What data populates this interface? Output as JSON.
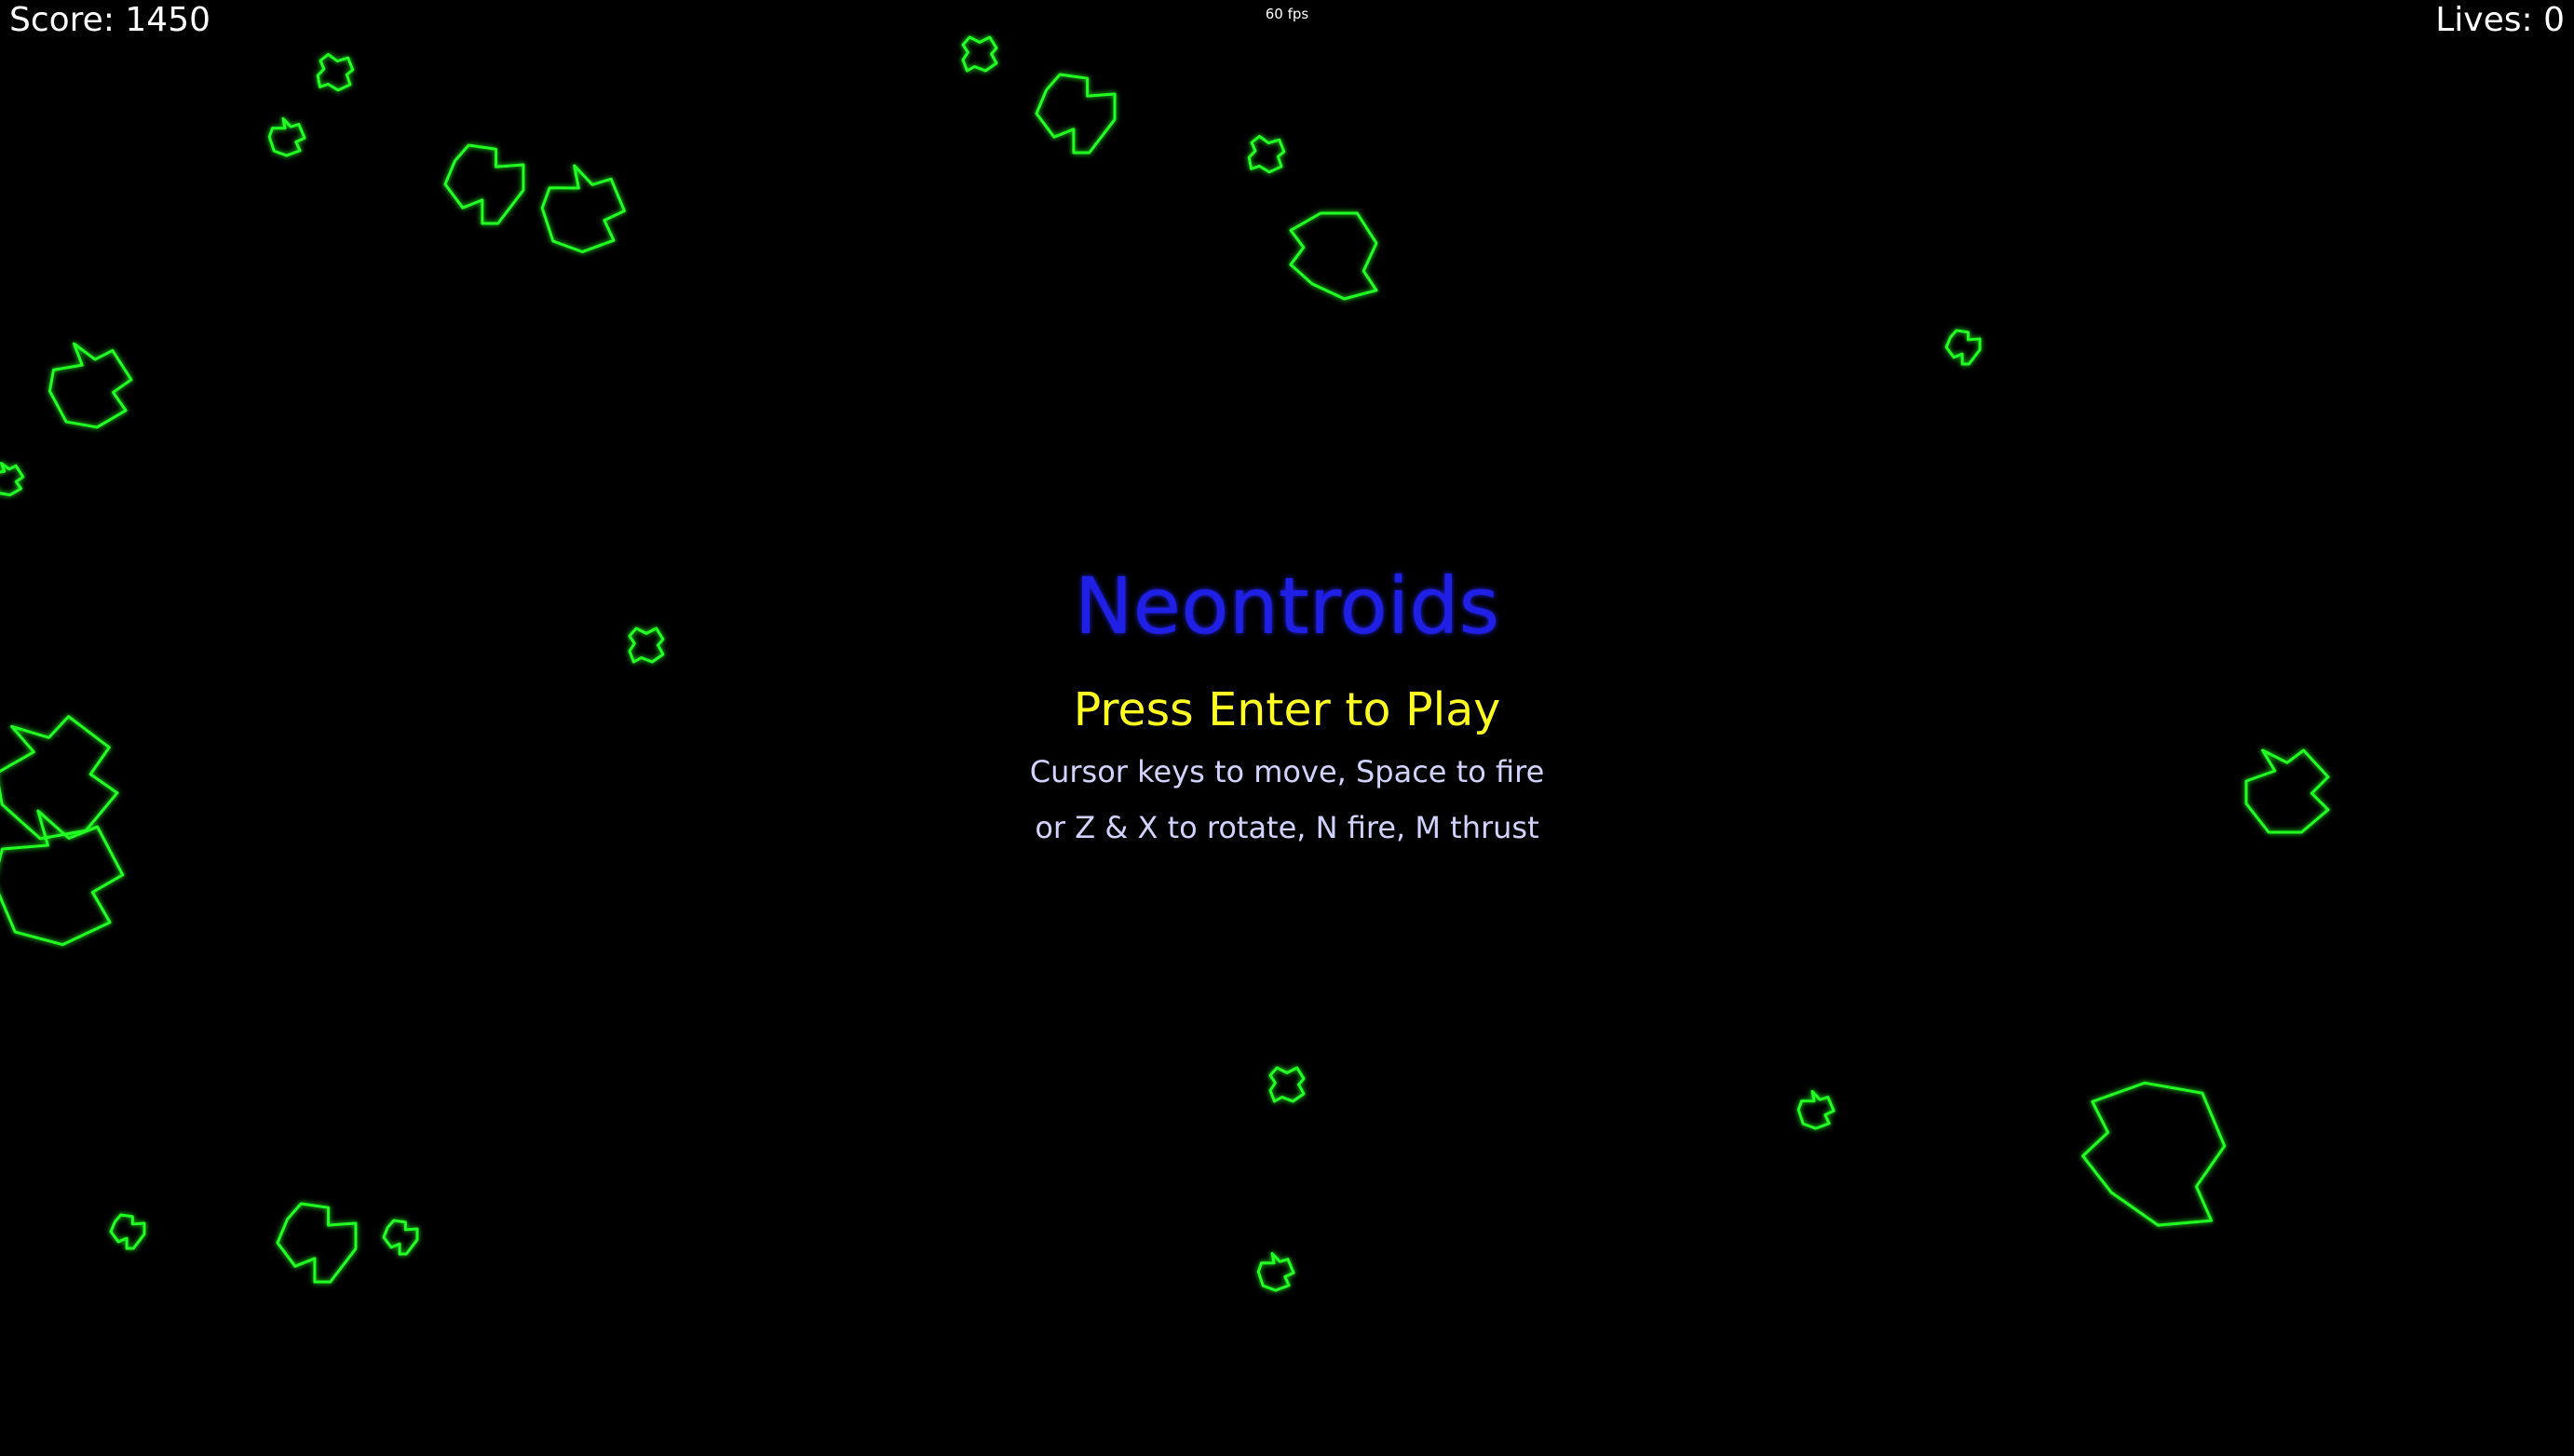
{
  "hud": {
    "score_text": "Score: 1450",
    "lives_text": "Lives: 0",
    "fps_text": "60 fps"
  },
  "menu": {
    "title": "Neontroids",
    "prompt": "Press Enter to Play",
    "help_line_1": "Cursor keys to move, Space to fire",
    "help_line_2": "or Z & X to rotate, N fire, M thrust"
  },
  "colors": {
    "background": "#000000",
    "asteroid_stroke": "#22ff22",
    "title": "#1f1fe6",
    "prompt": "#ffff22",
    "help": "#d2d2ff",
    "hud": "#ffffff"
  },
  "asteroid_count": 25
}
